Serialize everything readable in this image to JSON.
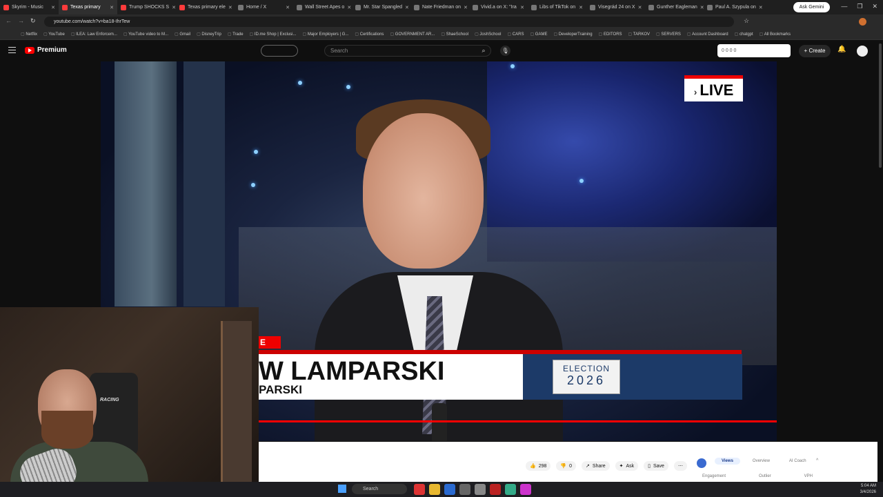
{
  "tabs": [
    {
      "title": "Skyrim - Music",
      "color": "#ff3b3b"
    },
    {
      "title": "Texas primary",
      "color": "#ff3b3b",
      "active": true
    },
    {
      "title": "Trump SHOCKS S",
      "color": "#ff3b3b"
    },
    {
      "title": "Texas primary ele",
      "color": "#ff3b3b"
    },
    {
      "title": "Home / X",
      "color": "#777777"
    },
    {
      "title": "Wall Street Apes o",
      "color": "#777777"
    },
    {
      "title": "Mr. Star Spangled",
      "color": "#777777"
    },
    {
      "title": "Nate Friedman on",
      "color": "#777777"
    },
    {
      "title": "Vivid.a on X: \"Ira",
      "color": "#777777"
    },
    {
      "title": "Libs of TikTok on",
      "color": "#777777"
    },
    {
      "title": "Visegrád 24 on X",
      "color": "#777777"
    },
    {
      "title": "Gunther Eagleman",
      "color": "#777777"
    },
    {
      "title": "Paul A. Szypula on",
      "color": "#777777"
    }
  ],
  "browser": {
    "ask_gemini": "Ask Gemini",
    "url": "youtube.com/watch?v=ba18-IhrTew"
  },
  "bookmarks": [
    "Netflix",
    "YouTube",
    "ILEA: Law Enforcem...",
    "YouTube video to M...",
    "Gmail",
    "DisneyTrip",
    "Trade",
    "ID.me Shop | Exclusi...",
    "Major Employers | G...",
    "Certifications",
    "GOVERNMENT AR...",
    "ShaeSchool",
    "JoshSchool",
    "CARS",
    "GAME",
    "DeveloperTraining",
    "EDITORS",
    "TARKOV",
    "SERVERS",
    "Account Dashboard",
    "chatgpt",
    "All Bookmarks"
  ],
  "youtube": {
    "brand": "Premium",
    "search_placeholder": "Search",
    "ext_counts": "0  0  0  0",
    "create_label": "Create"
  },
  "video": {
    "live_label": "LIVE",
    "lower_third_tag": "E",
    "name": "W LAMPARSKI",
    "subtitle": "PARSKI",
    "badge_top": "ELECTION",
    "badge_year": "2026",
    "channel_bug": "4"
  },
  "webcam": {
    "chair_text": "RACING"
  },
  "actions": {
    "likes": "298",
    "dislikes": "0",
    "share": "Share",
    "ask": "Ask",
    "save": "Save"
  },
  "panel": {
    "tabs": [
      "Views",
      "Overview",
      "AI Coach"
    ],
    "labels": [
      "Engagement",
      "Outlier",
      "VPH"
    ]
  },
  "taskbar": {
    "search": "Search",
    "time": "5:04 AM",
    "date": "3/4/2026"
  }
}
